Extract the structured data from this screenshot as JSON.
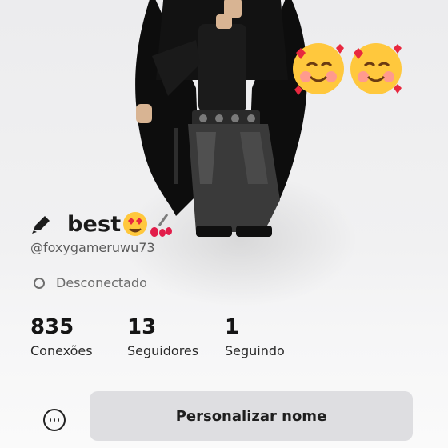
{
  "profile": {
    "display_name": "best",
    "username": "@foxygameruwu73",
    "status": "Desconectado"
  },
  "stats": [
    {
      "value": "835",
      "label": "Conexões"
    },
    {
      "value": "13",
      "label": "Seguidores"
    },
    {
      "value": "1",
      "label": "Seguindo"
    }
  ],
  "actions": {
    "primary_label": "Personalizar nome"
  },
  "icons": {
    "edit": "pencil-icon",
    "status": "offline-status-icon",
    "more": "more-options-icon",
    "emoji_name": [
      "heart-eyes-emoji",
      "nail-polish-emoji"
    ],
    "emoji_deco": [
      "smiling-face-with-hearts-emoji",
      "smiling-face-with-hearts-emoji"
    ]
  },
  "colors": {
    "button_bg": "#dedee1",
    "text_primary": "#1a1a1a",
    "text_secondary": "#5b5b5b"
  }
}
